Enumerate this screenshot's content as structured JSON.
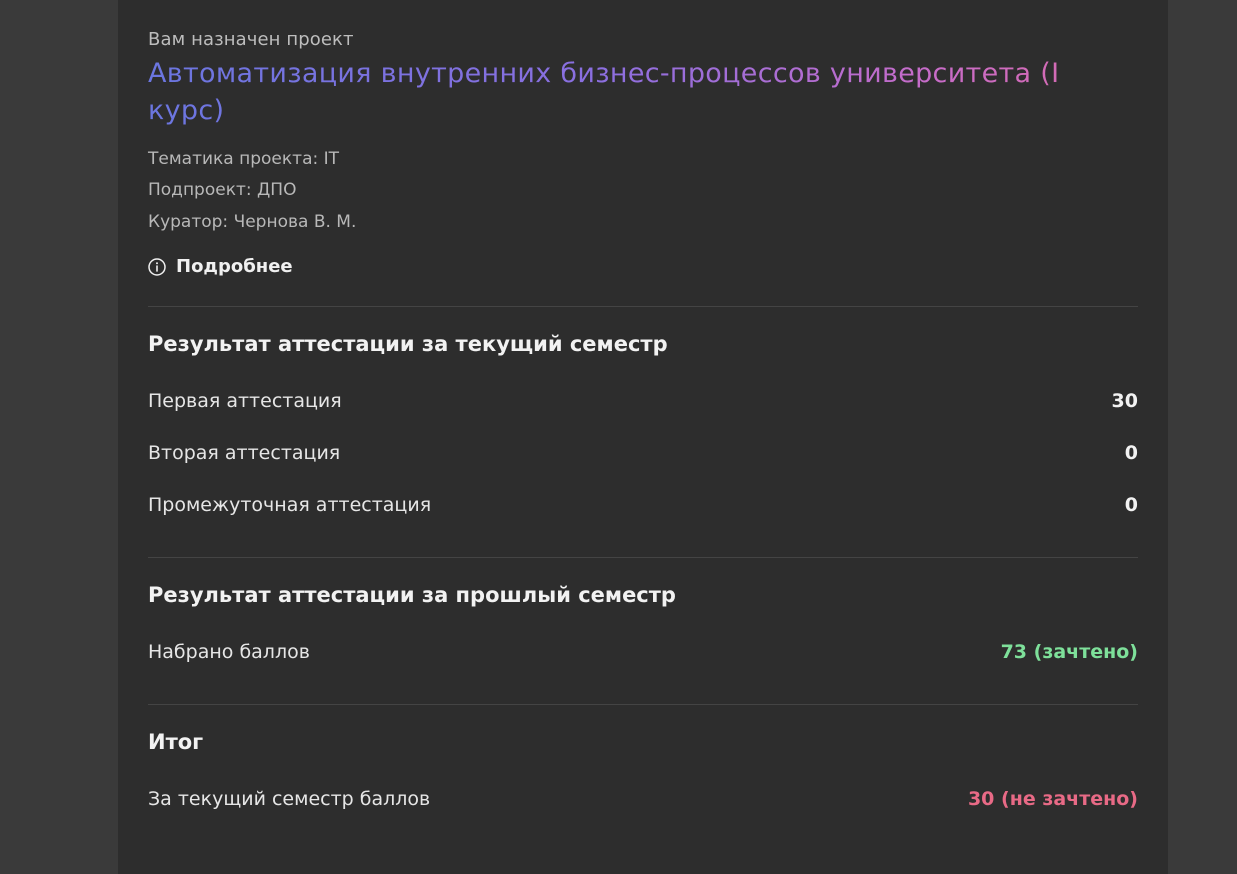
{
  "project": {
    "assigned_label": "Вам назначен проект",
    "title": "Автоматизация внутренних бизнес-процессов университета (I курс)",
    "theme": "Тематика проекта: IT",
    "subproject": "Подпроект: ДПО",
    "curator": "Куратор: Чернова В. М.",
    "more_label": "Подробнее",
    "more_icon": "info-icon"
  },
  "current_semester": {
    "title": "Результат аттестации за текущий семестр",
    "rows": [
      {
        "name": "Первая аттестация",
        "value": "30"
      },
      {
        "name": "Вторая аттестация",
        "value": "0"
      },
      {
        "name": "Промежуточная аттестация",
        "value": "0"
      }
    ]
  },
  "previous_semester": {
    "title": "Результат аттестации за прошлый семестр",
    "rows": [
      {
        "name": "Набрано баллов",
        "value": "73 (зачтено)",
        "status_color": "#7ee09a"
      }
    ]
  },
  "summary": {
    "title": "Итог",
    "rows": [
      {
        "name": "За текущий семестр баллов",
        "value": "30 (не зачтено)",
        "status_color": "#e86a86"
      }
    ]
  },
  "colors": {
    "page_bg": "#3a3a3a",
    "card_bg": "#2d2d2d",
    "title_gradient_start": "#6b76e0",
    "title_gradient_end": "#d96aa8",
    "passed": "#7ee09a",
    "failed": "#e86a86"
  }
}
